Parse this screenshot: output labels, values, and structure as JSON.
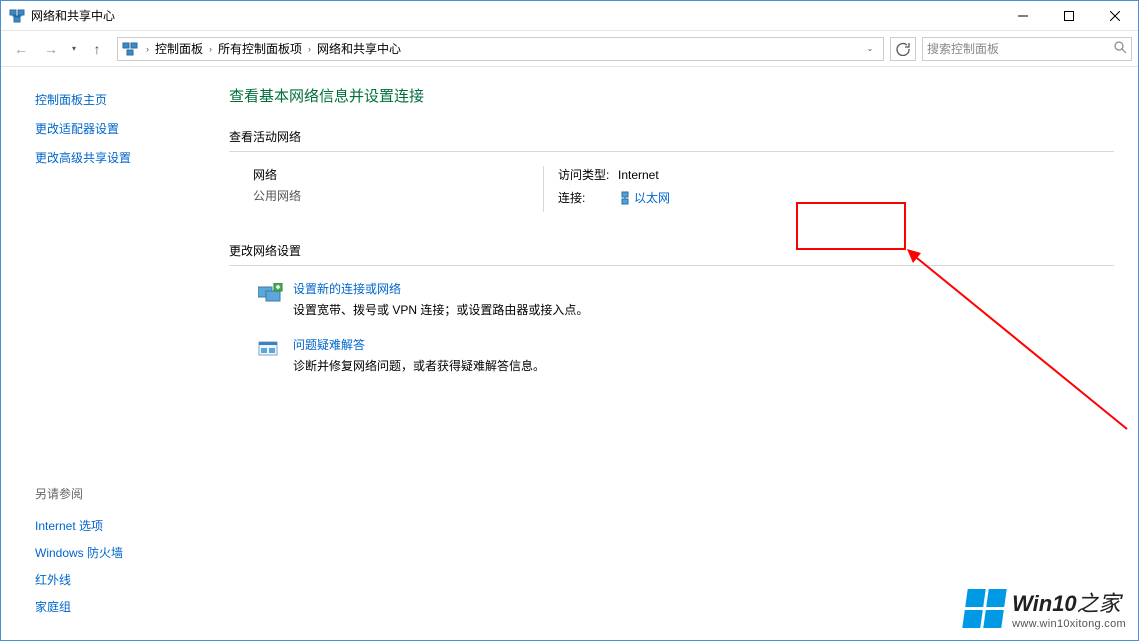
{
  "titlebar": {
    "title": "网络和共享中心"
  },
  "breadcrumbs": [
    "控制面板",
    "所有控制面板项",
    "网络和共享中心"
  ],
  "search": {
    "placeholder": "搜索控制面板"
  },
  "sidebar": {
    "links": [
      "控制面板主页",
      "更改适配器设置",
      "更改高级共享设置"
    ]
  },
  "see_also": {
    "heading": "另请参阅",
    "links": [
      "Internet 选项",
      "Windows 防火墙",
      "红外线",
      "家庭组"
    ]
  },
  "main": {
    "heading": "查看基本网络信息并设置连接",
    "active_section": "查看活动网络",
    "network": {
      "name": "网络",
      "type": "公用网络",
      "access_label": "访问类型:",
      "access_value": "Internet",
      "conn_label": "连接:",
      "conn_value": "以太网"
    },
    "change_section": "更改网络设置",
    "options": [
      {
        "title": "设置新的连接或网络",
        "desc": "设置宽带、拨号或 VPN 连接；或设置路由器或接入点。"
      },
      {
        "title": "问题疑难解答",
        "desc": "诊断并修复网络问题，或者获得疑难解答信息。"
      }
    ]
  },
  "watermark": {
    "brand_main": "Win10",
    "brand_sub": "之家",
    "url": "www.win10xitong.com"
  }
}
